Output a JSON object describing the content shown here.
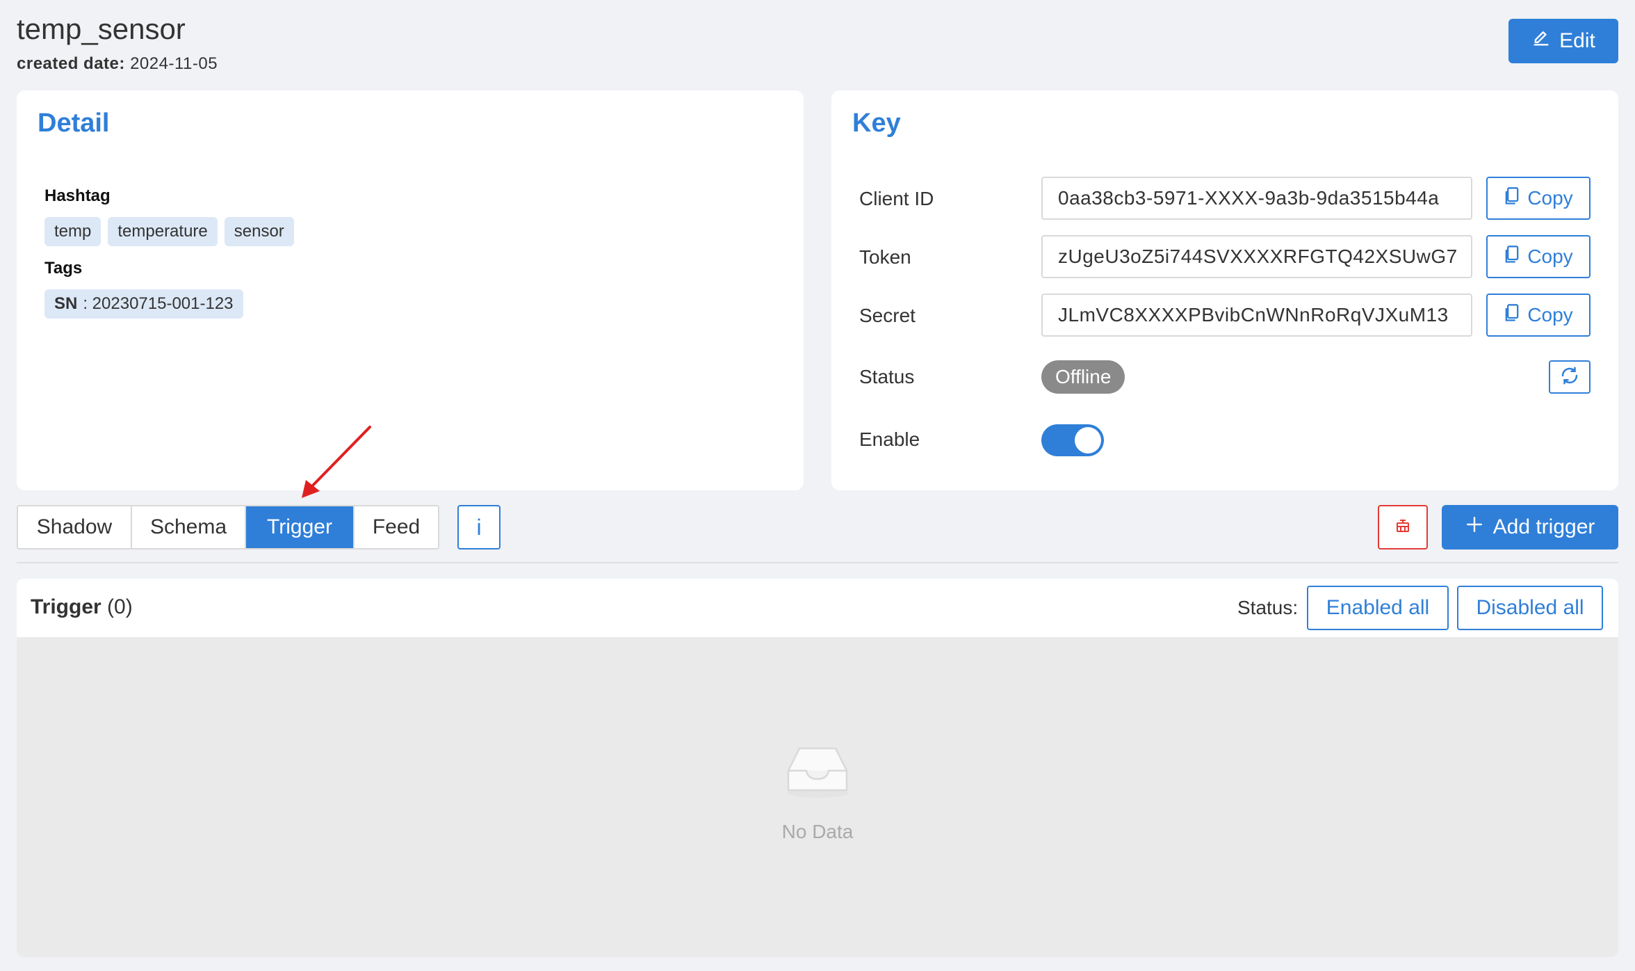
{
  "header": {
    "title": "temp_sensor",
    "created_label": "created date:",
    "created_value": "2024-11-05",
    "edit_label": "Edit"
  },
  "detail": {
    "title": "Detail",
    "hashtag_label": "Hashtag",
    "hashtags": [
      "temp",
      "temperature",
      "sensor"
    ],
    "tags_label": "Tags",
    "tag_key": "SN",
    "tag_value": ": 20230715-001-123"
  },
  "key": {
    "title": "Key",
    "client_id_label": "Client ID",
    "client_id_value": "0aa38cb3-5971-XXXX-9a3b-9da3515b44a",
    "token_label": "Token",
    "token_value": "zUgeU3oZ5i744SVXXXXRFGTQ42XSUwG7",
    "secret_label": "Secret",
    "secret_value": "JLmVC8XXXXPBvibCnWNnRoRqVJXuM13",
    "copy_label": "Copy",
    "status_label": "Status",
    "status_value": "Offline",
    "enable_label": "Enable",
    "enable_on": true
  },
  "tabs": {
    "items": [
      "Shadow",
      "Schema",
      "Trigger",
      "Feed"
    ],
    "active": "Trigger",
    "info_label": "i",
    "add_trigger_label": "Add trigger"
  },
  "trigger_panel": {
    "title": "Trigger",
    "count": "(0)",
    "status_label": "Status:",
    "enabled_all_label": "Enabled all",
    "disabled_all_label": "Disabled all",
    "empty_text": "No Data"
  },
  "colors": {
    "accent": "#2f7fd8",
    "danger": "#e53935",
    "status_offline": "#8a8a8a",
    "annotation": "#e02020"
  },
  "icons": [
    "edit-icon",
    "copy-icon",
    "refresh-icon",
    "delete-icon",
    "plus-icon",
    "empty-inbox-icon"
  ]
}
